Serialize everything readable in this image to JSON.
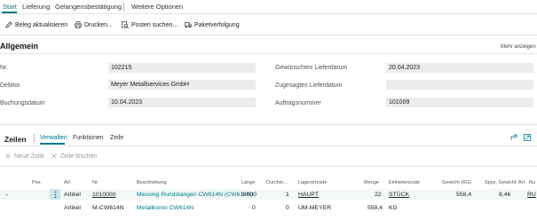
{
  "tabs": [
    {
      "label": "Start"
    },
    {
      "label": "Lieferung"
    },
    {
      "label": "Gelangensbestätigung"
    },
    {
      "label": "Weitere Optionen"
    }
  ],
  "actions": [
    {
      "label": "Beleg aktualisieren",
      "icon": "pencil-icon"
    },
    {
      "label": "Drucken...",
      "icon": "printer-icon"
    },
    {
      "label": "Posten suchen...",
      "icon": "search-doc-icon"
    },
    {
      "label": "Paketverfolgung",
      "icon": "truck-icon"
    }
  ],
  "general": {
    "title": "Allgemein",
    "more": "Mehr anzeigen",
    "fields_left": [
      {
        "label": "Nr.",
        "value": "102215"
      },
      {
        "label": "Debitor",
        "value": "Meyer Metallservices GmbH"
      },
      {
        "label": "Buchungsdatum",
        "value": "10.04.2023"
      }
    ],
    "fields_right": [
      {
        "label": "Gewünschtes Lieferdatum",
        "value": "20.04.2023"
      },
      {
        "label": "Zugesagtes Lieferdatum",
        "value": ""
      },
      {
        "label": "Auftragsnummer",
        "value": "101009"
      }
    ]
  },
  "lines": {
    "title": "Zeilen",
    "tabs": [
      "Verwalten",
      "Funktionen",
      "Zeile"
    ],
    "new_line": "Neue Zeile",
    "delete_line": "Zeile löschen",
    "columns": [
      "Pos.",
      "Art",
      "Nr.",
      "Beschreibung",
      "Länge",
      "Durchm...",
      "Lagerortcode",
      "Menge",
      "Einheitencode",
      "Gewicht (KG)",
      "Spez. Gewicht",
      "Art",
      "Ru"
    ],
    "rows": [
      {
        "marker": "→",
        "art": "Artikel",
        "nr": "1010000",
        "desc": "Messing Rundstangen CW614N (CW614N)",
        "laenge": "3.000",
        "durchm": "1",
        "lager": "HAUPT",
        "menge": "22",
        "einheit": "STÜCK",
        "gewicht": "558,4",
        "spez": "8,46",
        "art2": "RU"
      },
      {
        "marker": "",
        "art": "Artikel",
        "nr": "M-CW614N",
        "desc": "Metallkonto CW614N",
        "laenge": "0",
        "durchm": "0",
        "lager": "UM-MEYER",
        "menge": "558,4",
        "einheit": "KG",
        "gewicht": "",
        "spez": "",
        "art2": ""
      }
    ]
  },
  "colors": {
    "accent": "#00788a"
  }
}
